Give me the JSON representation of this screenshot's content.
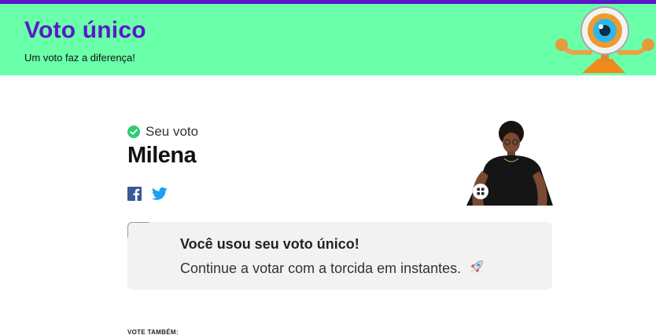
{
  "banner": {
    "title": "Voto único",
    "subtitle": "Um voto faz a diferença!"
  },
  "vote": {
    "label": "Seu voto",
    "candidate": "Milena"
  },
  "notice": {
    "title": "Você usou seu voto único!",
    "text": "Continue a votar com a torcida em instantes."
  },
  "section": {
    "vote_also_label": "VOTE TAMBÉM:"
  },
  "icons": {
    "check": "check-circle-icon",
    "facebook": "facebook-icon",
    "twitter": "twitter-icon",
    "rocket": "rocket-icon",
    "mascot": "big-brother-eye-mascot"
  },
  "colors": {
    "brand_purple": "#5a18c9",
    "banner_green": "#6affa9",
    "check_green": "#2ecc71",
    "facebook_blue": "#3b5998",
    "twitter_blue": "#1da1f2",
    "notice_bg": "#f2f2f2"
  }
}
